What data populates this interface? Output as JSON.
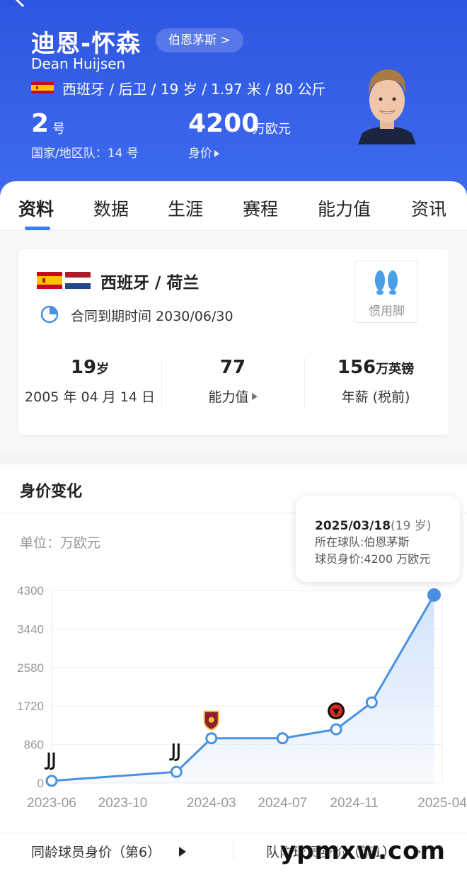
{
  "player": {
    "name_cn": "迪恩-怀森",
    "name_en": "Dean Huijsen",
    "club_link": "伯恩茅斯 >",
    "info": "西班牙 / 后卫 / 19 岁 / 1.97 米 / 80 公斤",
    "number": "2",
    "number_unit": "号",
    "national_team": "国家/地区队：14 号",
    "market_value": "4200",
    "market_value_unit": "万欧元",
    "market_value_label": "身价"
  },
  "tabs": [
    {
      "label": "资料",
      "active": true
    },
    {
      "label": "数据"
    },
    {
      "label": "生涯"
    },
    {
      "label": "赛程"
    },
    {
      "label": "能力值"
    },
    {
      "label": "资讯"
    }
  ],
  "profile": {
    "nationality": "西班牙 / 荷兰",
    "contract": "合同到期时间 2030/06/30",
    "preferred_foot_label": "惯用脚",
    "age_value": "19",
    "age_unit": "岁",
    "birth_date": "2005 年 04 月 14 日",
    "rating_value": "77",
    "rating_label": "能力值",
    "salary_value": "156",
    "salary_unit": "万英镑",
    "salary_label": "年薪 (税前)"
  },
  "value_section": {
    "title": "身价变化",
    "unit_label": "单位：万欧元",
    "tooltip": {
      "date": "2025/03/18",
      "age": "(19 岁)",
      "team_line": "所在球队:伯恩茅斯",
      "value_line": "球员身价:4200 万欧元"
    },
    "peer_link": "同龄球员身价（第6）",
    "team_link": "队内球员身价（第1）"
  },
  "chart_data": {
    "type": "area",
    "y_ticks": [
      "4300",
      "3440",
      "2580",
      "1720",
      "860",
      "0"
    ],
    "x_ticks": [
      "2023-06",
      "2023-10",
      "2024-03",
      "2024-07",
      "2024-11",
      "2025-04"
    ],
    "ylim": [
      0,
      4300
    ],
    "points": [
      {
        "date": "2023-06",
        "value": 50,
        "club_badge": "juventus"
      },
      {
        "date": "2024-01",
        "value": 250,
        "club_badge": "juventus"
      },
      {
        "date": "2024-03",
        "value": 1000,
        "club_badge": "roma"
      },
      {
        "date": "2024-07",
        "value": 1000
      },
      {
        "date": "2024-10",
        "value": 1200,
        "club_badge": "bournemouth"
      },
      {
        "date": "2024-12",
        "value": 1800
      },
      {
        "date": "2025-03-18",
        "value": 4200
      }
    ],
    "line_color": "#4a90e2",
    "fill_color": "#cfe2fb"
  },
  "watermark": "ypmxw.com"
}
